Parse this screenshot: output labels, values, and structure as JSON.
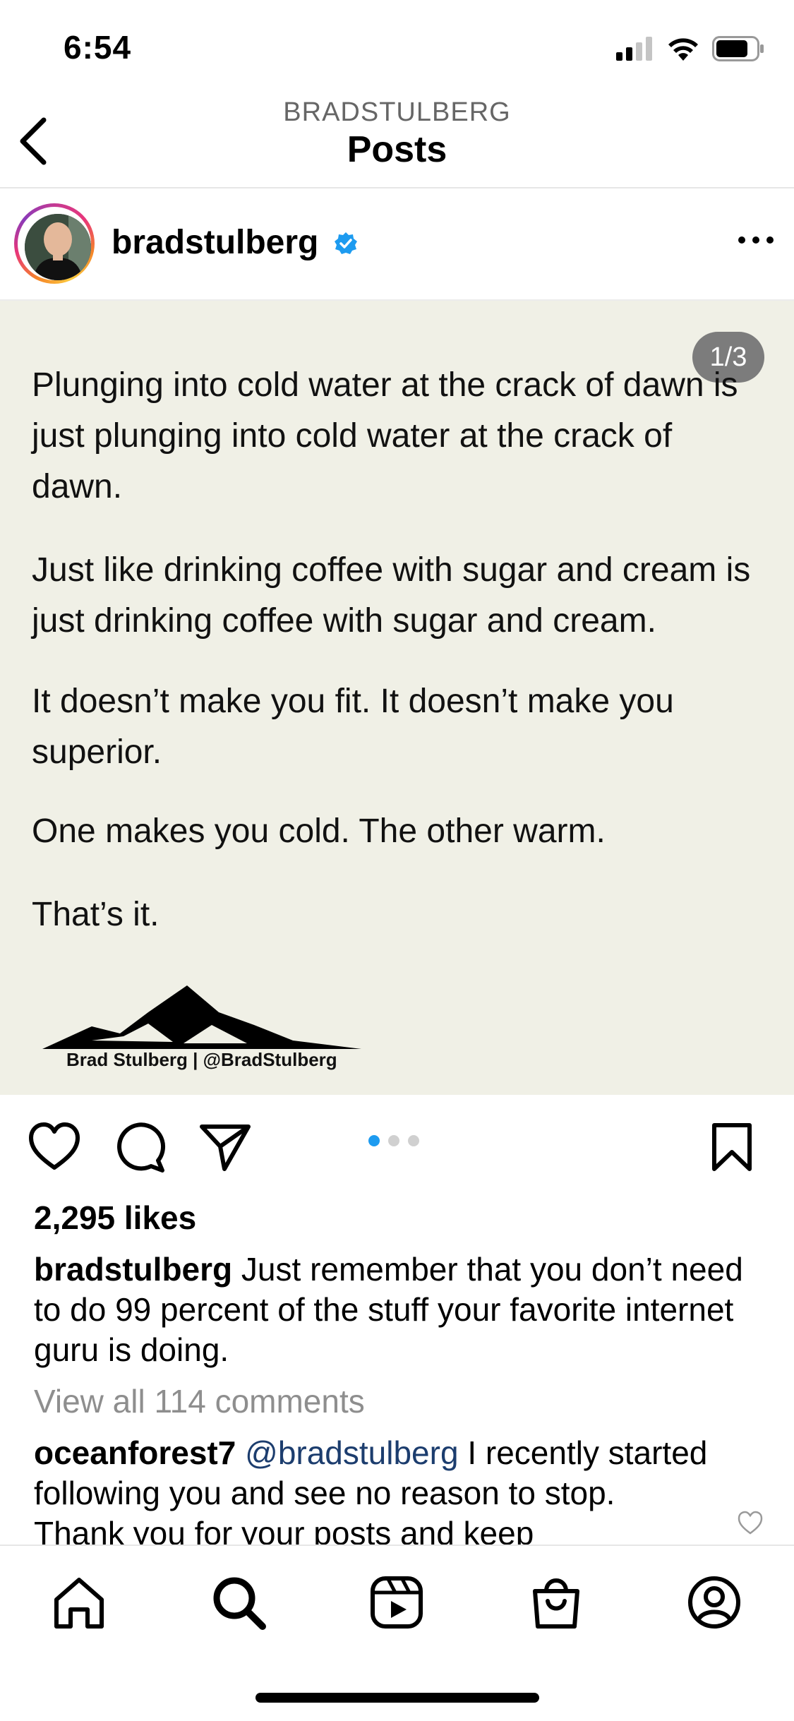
{
  "status_bar": {
    "time": "6:54"
  },
  "header": {
    "username": "BRADSTULBERG",
    "title": "Posts"
  },
  "post": {
    "username": "bradstulberg",
    "verified": true,
    "page_counter": "1/3",
    "image_paragraphs": [
      "Plunging into cold water at the crack of dawn is just plunging into cold water at the crack of dawn.",
      "Just like drinking coffee with sugar and cream is just drinking coffee with sugar and cream.",
      "It doesn’t make you fit. It doesn’t make you superior.",
      "One makes you cold. The other warm.",
      "That’s it."
    ],
    "logo_text": "Brad Stulberg | @BradStulberg",
    "likes": "2,295 likes",
    "caption_user": "bradstulberg",
    "caption_text": " Just remember that you don’t need to do 99 percent of the stuff your favorite internet guru is doing.",
    "view_comments": "View all 114 comments",
    "comment": {
      "user": "oceanforest7",
      "mention": " @bradstulberg",
      "text": " I recently started following you and see no reason to stop. Thank you for your posts and keep"
    },
    "carousel": {
      "total": 3,
      "active": 1
    }
  },
  "colors": {
    "accent": "#1d9bf0",
    "image_background": "#f0f0e6",
    "mention": "#1c3d6e"
  },
  "icons": [
    "back-chevron-icon",
    "verified-badge-icon",
    "more-icon",
    "heart-icon",
    "comment-icon",
    "share-icon",
    "bookmark-icon",
    "home-icon",
    "search-icon",
    "reels-icon",
    "shop-icon",
    "profile-icon"
  ]
}
